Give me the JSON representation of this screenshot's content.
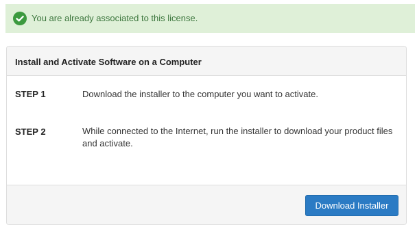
{
  "alert": {
    "message": "You are already associated to this license.",
    "icon": "check-circle-icon",
    "color": "#3c763d",
    "background": "#dff0d8"
  },
  "panel": {
    "title": "Install and Activate Software on a Computer",
    "steps": [
      {
        "label": "STEP 1",
        "text": "Download the installer to the computer you want to activate."
      },
      {
        "label": "STEP 2",
        "text": "While connected to the Internet, run the installer to download your product files and activate."
      }
    ],
    "footer": {
      "button_label": "Download Installer",
      "button_color": "#2b7bc4"
    }
  }
}
